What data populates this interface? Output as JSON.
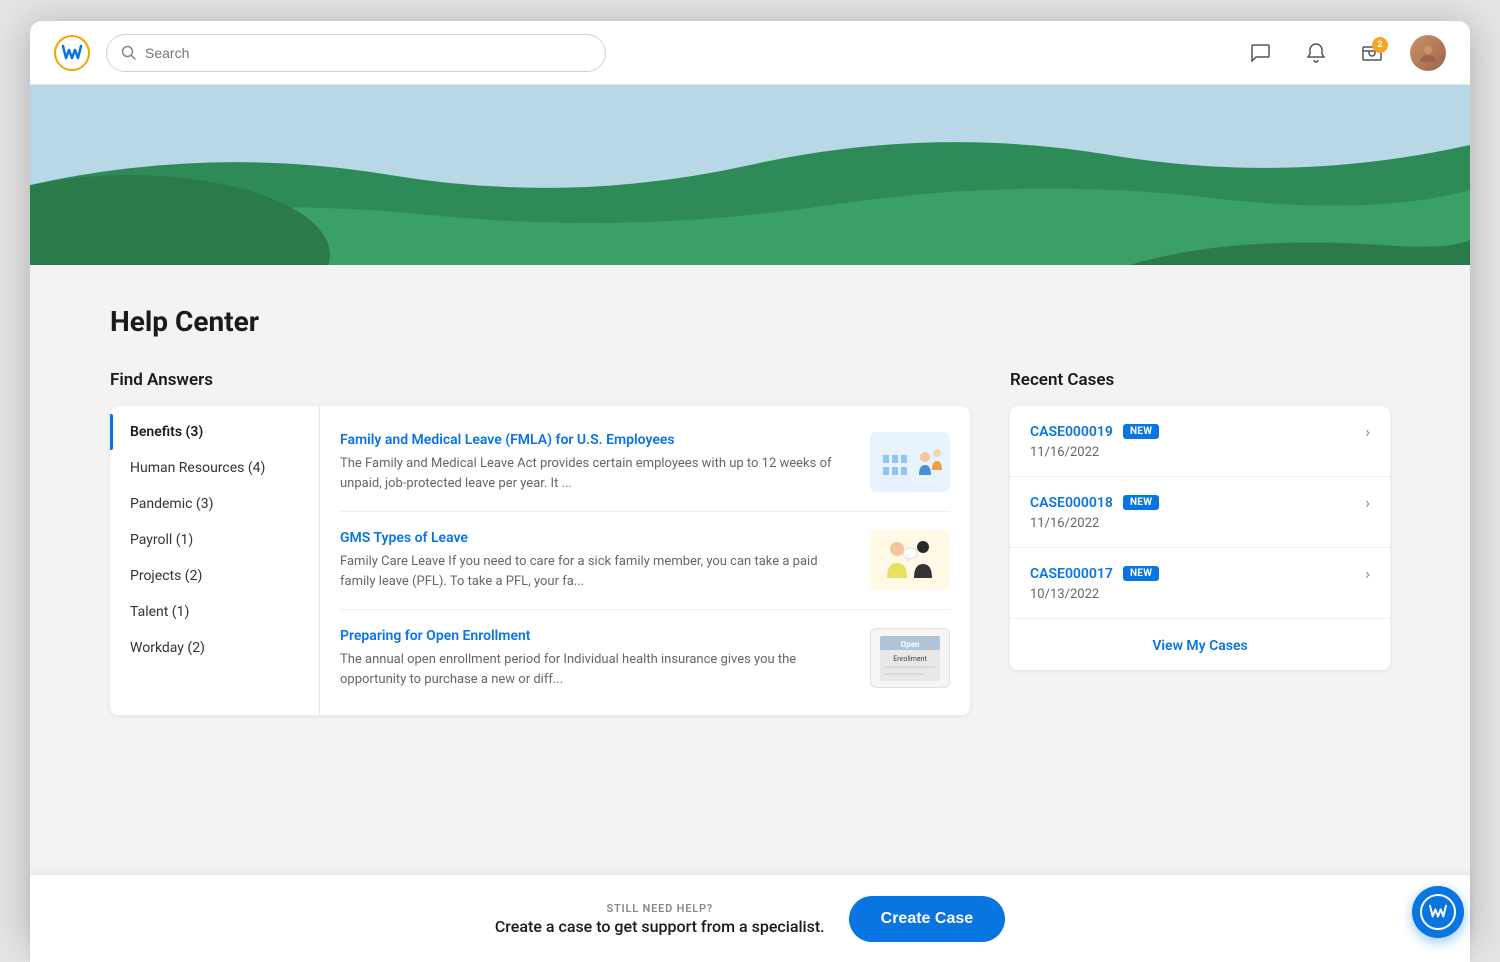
{
  "nav": {
    "logo_letter": "W",
    "search_placeholder": "Search",
    "notification_count": "2"
  },
  "page": {
    "title": "Help Center"
  },
  "find_answers": {
    "section_title": "Find Answers",
    "categories": [
      {
        "label": "Benefits (3)",
        "active": true
      },
      {
        "label": "Human Resources (4)",
        "active": false
      },
      {
        "label": "Pandemic (3)",
        "active": false
      },
      {
        "label": "Payroll (1)",
        "active": false
      },
      {
        "label": "Projects (2)",
        "active": false
      },
      {
        "label": "Talent (1)",
        "active": false
      },
      {
        "label": "Workday (2)",
        "active": false
      }
    ],
    "articles": [
      {
        "title": "Family and Medical Leave (FMLA) for U.S. Employees",
        "excerpt": "The Family and Medical Leave Act provides certain employees with up to 12 weeks of unpaid, job-protected leave per year. It ...",
        "thumb_type": "fmla",
        "thumb_emoji": "🏢"
      },
      {
        "title": "GMS Types of Leave",
        "excerpt": "Family Care Leave If you need to care for a sick family member, you can take a paid family leave (PFL). To take a PFL, your fa...",
        "thumb_type": "gms",
        "thumb_emoji": "👥"
      },
      {
        "title": "Preparing for Open Enrollment",
        "excerpt": "The annual open enrollment period for Individual health insurance gives you the opportunity to purchase a new or diff...",
        "thumb_type": "enrollment",
        "thumb_emoji": "📋"
      }
    ]
  },
  "recent_cases": {
    "section_title": "Recent Cases",
    "cases": [
      {
        "number": "CASE000019",
        "badge": "NEW",
        "date": "11/16/2022"
      },
      {
        "number": "CASE000018",
        "badge": "NEW",
        "date": "11/16/2022"
      },
      {
        "number": "CASE000017",
        "badge": "NEW",
        "date": "10/13/2022"
      }
    ],
    "view_link": "View My Cases"
  },
  "footer": {
    "still_need_help": "STILL NEED HELP?",
    "description": "Create a case to get support from a specialist.",
    "create_case_btn": "Create Case"
  }
}
